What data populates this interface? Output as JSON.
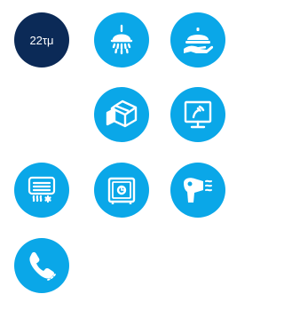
{
  "colors": {
    "tile": "#0aa7e8",
    "area_tile": "#0b2a57",
    "icon": "#ffffff"
  },
  "amenities": [
    {
      "id": "area",
      "label": "22τμ"
    },
    {
      "id": "shower",
      "icon": "shower-icon"
    },
    {
      "id": "room-service",
      "icon": "room-service-icon"
    },
    {
      "id": "minibar",
      "icon": "minibar-icon"
    },
    {
      "id": "tv",
      "icon": "tv-icon"
    },
    {
      "id": "air-conditioning",
      "icon": "air-conditioner-icon"
    },
    {
      "id": "safe",
      "icon": "safe-icon"
    },
    {
      "id": "hair-dryer",
      "icon": "hair-dryer-icon"
    },
    {
      "id": "telephone",
      "icon": "telephone-icon"
    }
  ]
}
